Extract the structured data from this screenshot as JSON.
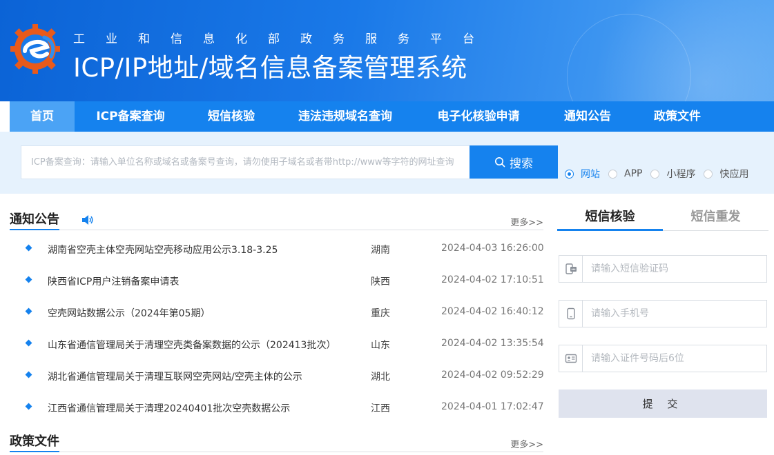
{
  "header": {
    "subtitle": "工业和信息化部政务服务平台",
    "title": "ICP/IP地址/域名信息备案管理系统"
  },
  "nav": {
    "items": [
      {
        "label": "首页",
        "width": 94
      },
      {
        "label": "ICP备案查询",
        "width": 162
      },
      {
        "label": "短信核验",
        "width": 130
      },
      {
        "label": "违法违规域名查询",
        "width": 200
      },
      {
        "label": "电子化核验申请",
        "width": 186
      },
      {
        "label": "通知公告",
        "width": 130
      },
      {
        "label": "政策文件",
        "width": 130
      }
    ]
  },
  "search": {
    "placeholder": "ICP备案查询：请输入单位名称或域名或备案号查询，请勿使用子域名或者带http://www等字符的网址查询",
    "button_label": "搜索",
    "options": [
      {
        "label": "网站",
        "checked": true
      },
      {
        "label": "APP",
        "checked": false
      },
      {
        "label": "小程序",
        "checked": false
      },
      {
        "label": "快应用",
        "checked": false
      }
    ]
  },
  "notices": {
    "title": "通知公告",
    "more": "更多>>",
    "items": [
      {
        "title": "湖南省空壳主体空壳网站空壳移动应用公示3.18-3.25",
        "region": "湖南",
        "date": "2024-04-03 16:26:00"
      },
      {
        "title": "陕西省ICP用户注销备案申请表",
        "region": "陕西",
        "date": "2024-04-02 17:10:51"
      },
      {
        "title": "空壳网站数据公示（2024年第05期）",
        "region": "重庆",
        "date": "2024-04-02 16:40:12"
      },
      {
        "title": "山东省通信管理局关于清理空壳类备案数据的公示（202413批次）",
        "region": "山东",
        "date": "2024-04-02 13:35:54"
      },
      {
        "title": "湖北省通信管理局关于清理互联网空壳网站/空壳主体的公示",
        "region": "湖北",
        "date": "2024-04-02 09:52:29"
      },
      {
        "title": "江西省通信管理局关于清理20240401批次空壳数据公示",
        "region": "江西",
        "date": "2024-04-01 17:02:47"
      }
    ]
  },
  "policies": {
    "title": "政策文件",
    "more": "更多>>"
  },
  "sms": {
    "tabs": [
      "短信核验",
      "短信重发"
    ],
    "code_placeholder": "请输入短信验证码",
    "phone_placeholder": "请输入手机号",
    "id_placeholder": "请输入证件号码后6位",
    "submit_label": "提 交"
  },
  "colors": {
    "primary": "#1582ee",
    "nav_active": "#4ba3f5",
    "search_band": "#e6f2fd"
  }
}
